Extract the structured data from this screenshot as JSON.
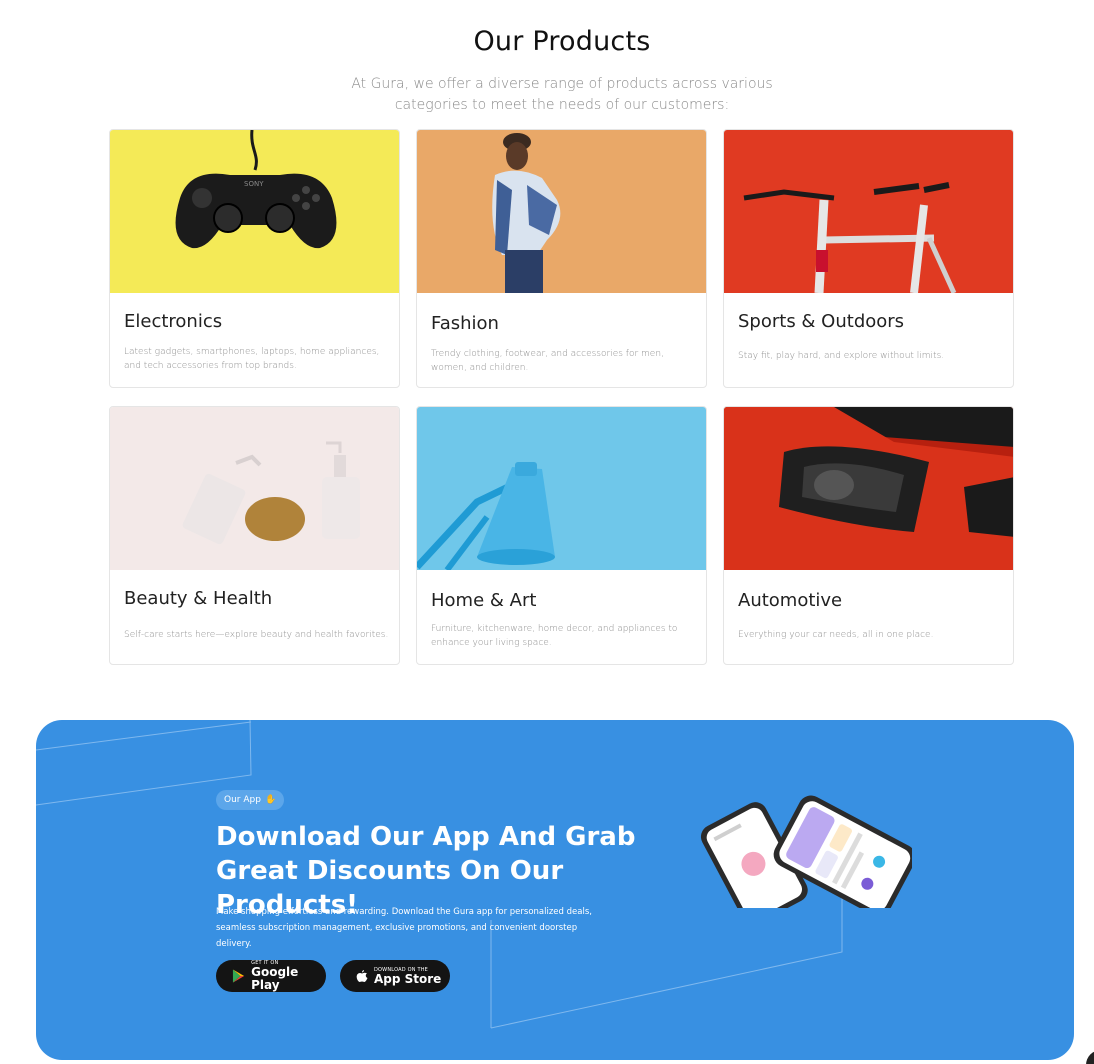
{
  "products": {
    "title": "Our Products",
    "subtitle": "At Gura, we offer a diverse range of products across various categories to meet the needs of our customers:",
    "cards": [
      {
        "title": "Electronics",
        "desc": "Latest gadgets, smartphones, laptops, home appliances, and tech accessories from top brands.",
        "image": "game-controller-image"
      },
      {
        "title": "Fashion",
        "desc": "Trendy clothing, footwear, and accessories for men, women, and children.",
        "image": "fashion-model-image"
      },
      {
        "title": "Sports & Outdoors",
        "desc": "Stay fit, play hard, and explore without limits.",
        "image": "bicycle-image"
      },
      {
        "title": "Beauty & Health",
        "desc": "Self-care starts here—explore beauty and health favorites.",
        "image": "cosmetics-bottles-image"
      },
      {
        "title": "Home & Art",
        "desc": "Furniture, kitchenware, home decor, and appliances to enhance your living space.",
        "image": "desk-lamp-image"
      },
      {
        "title": "Automotive",
        "desc": "Everything your car needs, all in one place.",
        "image": "car-headlight-image"
      }
    ]
  },
  "app_banner": {
    "pill_label": "Our App",
    "pill_icon": "hand-wave-icon",
    "title": "Download Our App And Grab Great Discounts On Our Products!",
    "description": "Make shopping effortless and rewarding. Download the Gura app for personalized deals, seamless subscription management, exclusive promotions, and convenient doorstep delivery.",
    "google_play": {
      "small": "GET IT ON",
      "big": "Google Play",
      "icon": "google-play-icon"
    },
    "app_store": {
      "small": "DOWNLOAD ON THE",
      "big": "App Store",
      "icon": "apple-icon"
    },
    "color": "#3890e2"
  }
}
